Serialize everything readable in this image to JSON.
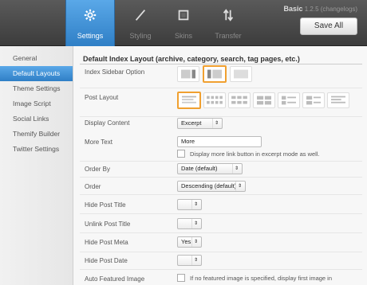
{
  "header": {
    "tabs": [
      {
        "label": "Settings",
        "icon": "gear-icon",
        "active": true
      },
      {
        "label": "Styling",
        "icon": "brush-icon",
        "active": false
      },
      {
        "label": "Skins",
        "icon": "skins-icon",
        "active": false
      },
      {
        "label": "Transfer",
        "icon": "transfer-arrows-icon",
        "active": false
      }
    ],
    "theme_name": "Basic",
    "version_text": "1.2.5 (changelogs)",
    "save_label": "Save All"
  },
  "sidebar": {
    "items": [
      {
        "label": "General",
        "active": false
      },
      {
        "label": "Default Layouts",
        "active": true
      },
      {
        "label": "Theme Settings",
        "active": false
      },
      {
        "label": "Image Script",
        "active": false
      },
      {
        "label": "Social Links",
        "active": false
      },
      {
        "label": "Themify Builder",
        "active": false
      },
      {
        "label": "Twitter Settings",
        "active": false
      }
    ]
  },
  "main": {
    "section_title": "Default Index Layout (archive, category, search, tag pages, etc.)",
    "fields": {
      "index_sidebar_option": {
        "label": "Index Sidebar Option"
      },
      "post_layout": {
        "label": "Post Layout"
      },
      "display_content": {
        "label": "Display Content",
        "value": "Excerpt"
      },
      "more_text": {
        "label": "More Text",
        "value": "More",
        "checkbox_label": "Display more link button in excerpt mode as well."
      },
      "order_by": {
        "label": "Order By",
        "value": "Date (default)"
      },
      "order": {
        "label": "Order",
        "value": "Descending (default)"
      },
      "hide_post_title": {
        "label": "Hide Post Title",
        "value": ""
      },
      "unlink_post_title": {
        "label": "Unlink Post Title",
        "value": ""
      },
      "hide_post_meta": {
        "label": "Hide Post Meta",
        "value": "Yes"
      },
      "hide_post_date": {
        "label": "Hide Post Date",
        "value": ""
      },
      "auto_featured_image": {
        "label": "Auto Featured Image",
        "checkbox_label": "If no featured image is specified, display first image in"
      }
    }
  },
  "colors": {
    "accent": "#3b8fd6",
    "selected_border": "#f0a030",
    "header_bg": "#444444"
  }
}
